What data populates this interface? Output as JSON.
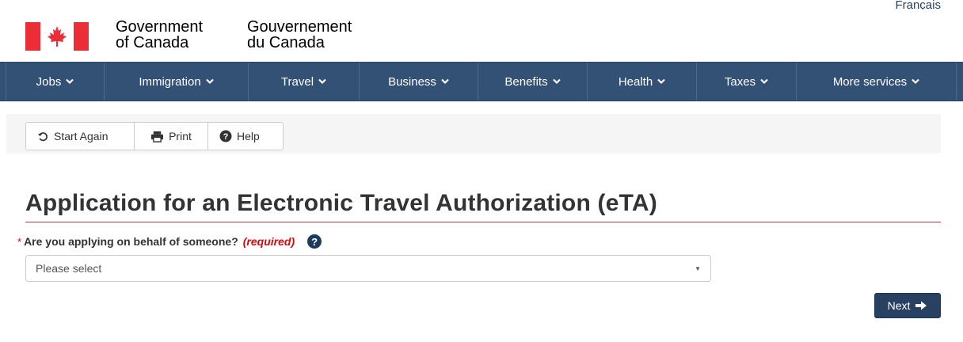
{
  "header": {
    "language_link": "Français",
    "signature_en_line1": "Government",
    "signature_en_line2": "of Canada",
    "signature_fr_line1": "Gouvernement",
    "signature_fr_line2": "du Canada",
    "flag_color": "#eb2d37"
  },
  "nav": {
    "background": "#335075",
    "items": [
      {
        "label": "Jobs",
        "icon": "chevron-down-icon"
      },
      {
        "label": "Immigration",
        "icon": "chevron-down-icon"
      },
      {
        "label": "Travel",
        "icon": "chevron-down-icon"
      },
      {
        "label": "Business",
        "icon": "chevron-down-icon"
      },
      {
        "label": "Benefits",
        "icon": "chevron-down-icon"
      },
      {
        "label": "Health",
        "icon": "chevron-down-icon"
      },
      {
        "label": "Taxes",
        "icon": "chevron-down-icon"
      },
      {
        "label": "More services",
        "icon": "chevron-down-icon"
      }
    ]
  },
  "toolbar": {
    "start_again_label": "Start Again",
    "print_label": "Print",
    "help_label": "Help"
  },
  "main": {
    "title": "Application for an Electronic Travel Authorization (eTA)",
    "question": {
      "required_marker": "*",
      "label": "Are you applying on behalf of someone?",
      "required_text": "(required)",
      "help_icon": "?"
    },
    "select": {
      "value": "Please select"
    },
    "next_label": "Next"
  }
}
